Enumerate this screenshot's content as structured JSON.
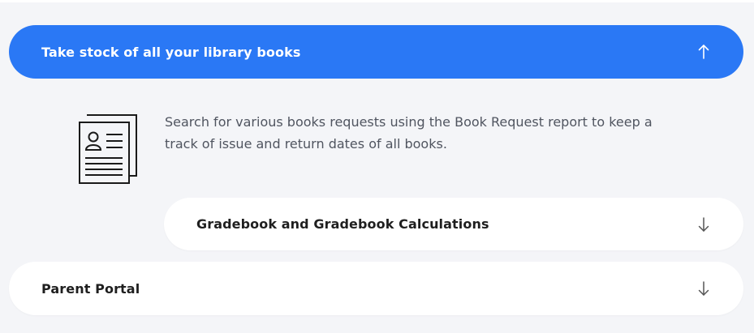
{
  "accordion": {
    "active_item": {
      "title": "Take stock of all your library books",
      "arrow_icon": "arrow-up-icon",
      "background": "#2a78f5",
      "content": {
        "icon": "document-profile-icon",
        "text": "Search for various books requests using the Book Request report to keep a track of issue and return dates of all books."
      }
    },
    "nested_item": {
      "title": "Gradebook and Gradebook Calculations",
      "arrow_icon": "arrow-down-icon"
    },
    "bottom_item": {
      "title": "Parent Portal",
      "arrow_icon": "arrow-down-icon"
    }
  },
  "colors": {
    "panel_background": "#f4f5f8",
    "accent": "#2a78f5",
    "text_dark": "#1f1f1f",
    "text_muted": "#505560"
  }
}
